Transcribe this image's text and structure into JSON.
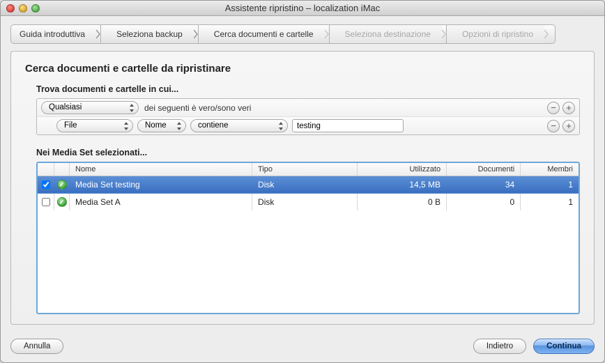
{
  "window": {
    "title": "Assistente ripristino – localization iMac"
  },
  "breadcrumb": {
    "items": [
      {
        "label": "Guida introduttiva",
        "enabled": true
      },
      {
        "label": "Seleziona backup",
        "enabled": true
      },
      {
        "label": "Cerca documenti e cartelle",
        "enabled": true
      },
      {
        "label": "Seleziona destinazione",
        "enabled": false
      },
      {
        "label": "Opzioni di ripristino",
        "enabled": false
      }
    ]
  },
  "main": {
    "heading": "Cerca documenti e cartelle da ripristinare",
    "criteria_label": "Trova documenti e cartelle in cui...",
    "criteria": {
      "scope_selector": "Qualsiasi",
      "scope_suffix": "dei seguenti è vero/sono veri",
      "rule": {
        "kind": "File",
        "field": "Nome",
        "operator": "contiene",
        "value": "testing"
      }
    },
    "mediasets_label": "Nei Media Set selezionati...",
    "table": {
      "columns": {
        "name": "Nome",
        "type": "Tipo",
        "used": "Utilizzato",
        "docs": "Documenti",
        "members": "Membri"
      },
      "rows": [
        {
          "checked": true,
          "status": "ok",
          "name": "Media Set testing",
          "type": "Disk",
          "used": "14,5 MB",
          "docs": "34",
          "members": "1",
          "selected": true
        },
        {
          "checked": false,
          "status": "ok",
          "name": "Media Set A",
          "type": "Disk",
          "used": "0 B",
          "docs": "0",
          "members": "1",
          "selected": false
        }
      ]
    }
  },
  "footer": {
    "cancel": "Annulla",
    "back": "Indietro",
    "continue": "Continua"
  }
}
